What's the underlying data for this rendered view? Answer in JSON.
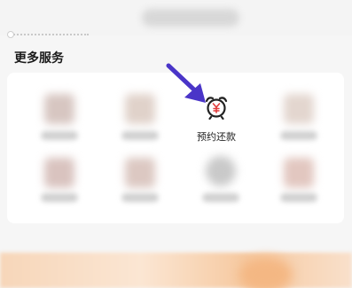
{
  "section": {
    "title": "更多服务"
  },
  "featured_service": {
    "label": "预约还款",
    "icon": "yen-alarm-clock-icon",
    "accent": "#e23b3b"
  },
  "pointer": {
    "icon": "arrow-pointer-icon",
    "color": "#4a35c8"
  }
}
